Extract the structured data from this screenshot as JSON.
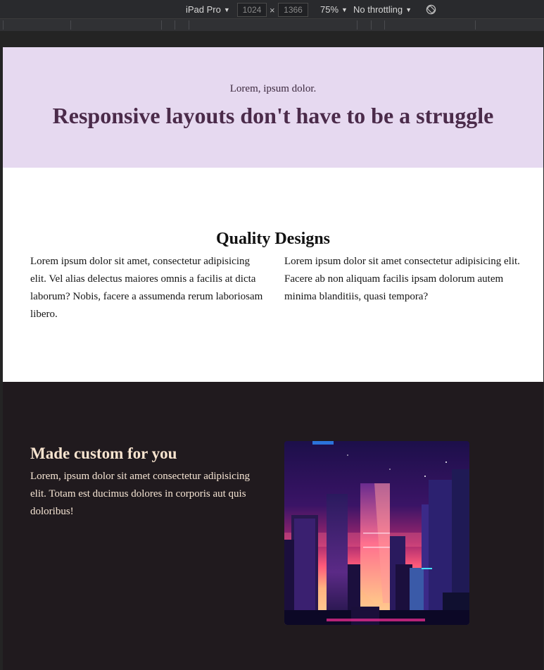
{
  "devtools": {
    "device": "iPad Pro",
    "width": "1024",
    "times": "×",
    "height": "1366",
    "zoom": "75%",
    "throttling": "No throttling"
  },
  "hero": {
    "subtitle": "Lorem, ipsum dolor.",
    "title": "Responsive layouts don't have to be a struggle",
    "background": "#e6d9f0"
  },
  "quality": {
    "title": "Quality Designs",
    "col1": "Lorem ipsum dolor sit amet, consectetur adipisicing elit. Vel alias delectus maiores omnis a facilis at dicta laborum? Nobis, facere a assumenda rerum laboriosam libero.",
    "col2": "Lorem ipsum dolor sit amet consectetur adipisicing elit. Facere ab non aliquam facilis ipsam dolorum autem minima blanditiis, quasi tempora?"
  },
  "custom": {
    "title": "Made custom for you",
    "text": "Lorem, ipsum dolor sit amet consectetur adipisicing elit. Totam est ducimus dolores in corporis aut quis doloribus!",
    "image": "synthwave-city-skyline",
    "background": "#201a1e"
  }
}
